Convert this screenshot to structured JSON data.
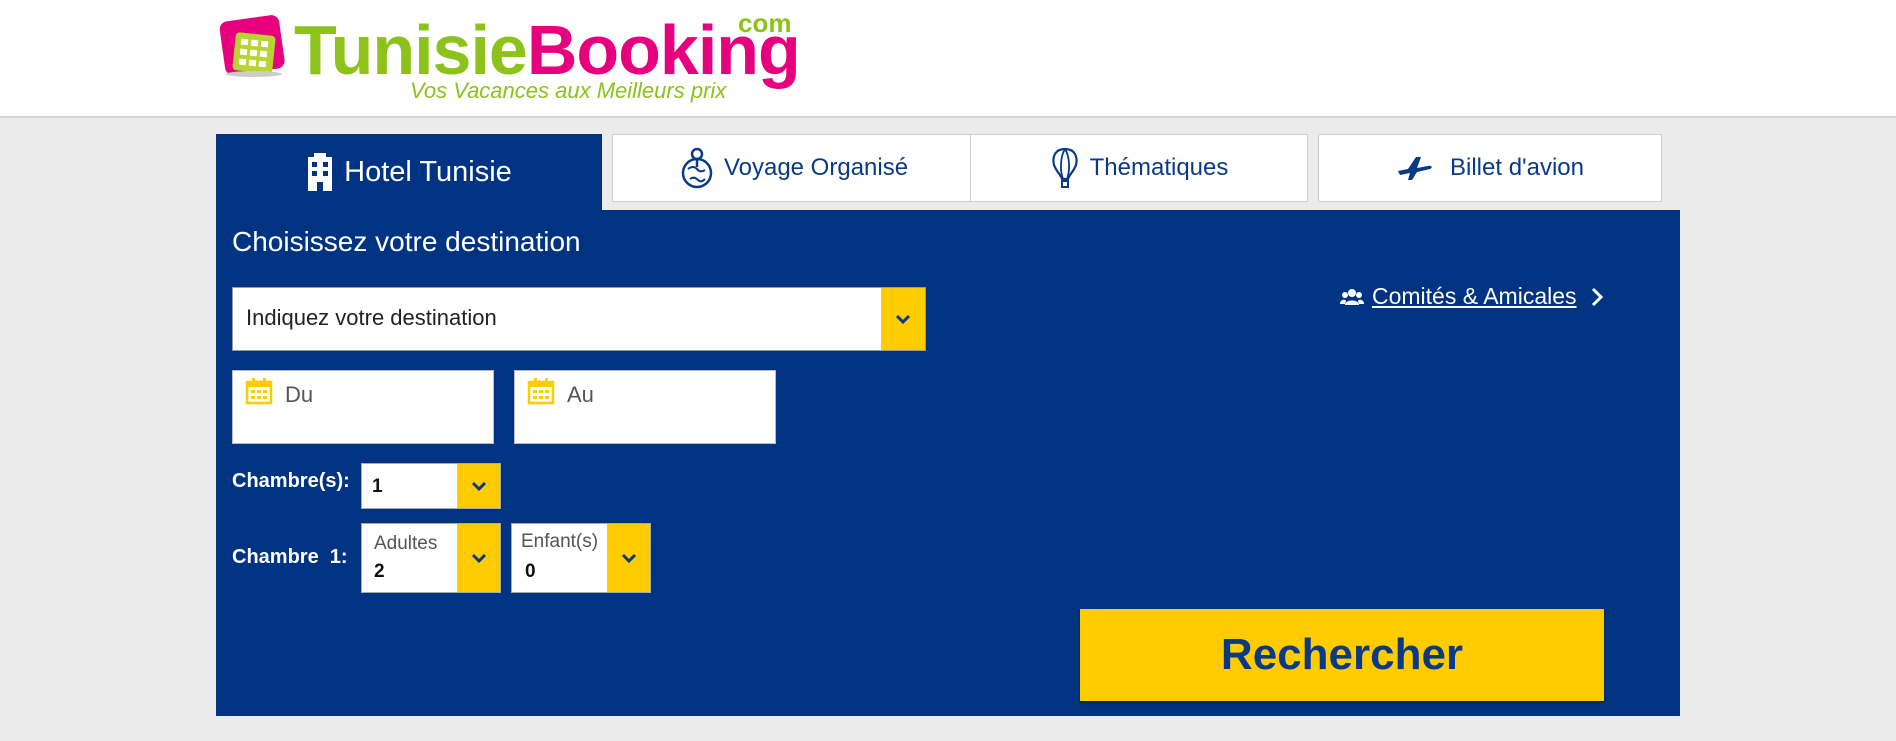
{
  "brand": {
    "name_part1": "Tunisie",
    "name_part2": "Booking",
    "suffix": "com",
    "slogan": "Vos Vacances aux Meilleurs prix",
    "colors": {
      "green": "#8cc21a",
      "magenta": "#e6007e",
      "navy": "#003483",
      "yellow": "#ffcc00"
    }
  },
  "tabs": [
    {
      "label": "Hotel Tunisie",
      "icon": "building-icon",
      "active": true
    },
    {
      "label": "Voyage Organisé",
      "icon": "globe-pin-icon",
      "active": false
    },
    {
      "label": "Thématiques",
      "icon": "balloon-icon",
      "active": false
    },
    {
      "label": "Billet d'avion",
      "icon": "airplane-icon",
      "active": false
    }
  ],
  "search": {
    "title": "Choisissez votre destination",
    "destination_placeholder": "Indiquez votre destination",
    "date_from_placeholder": "Du",
    "date_to_placeholder": "Au",
    "rooms_label": "Chambre(s):",
    "rooms_value": "1",
    "room1_label": "Chambre  1:",
    "adults_label": "Adultes",
    "adults_value": "2",
    "children_label": "Enfant(s)",
    "children_value": "0",
    "submit_label": "Rechercher"
  },
  "committees_link": {
    "label": "Comités & Amicales",
    "icon": "users-icon"
  }
}
